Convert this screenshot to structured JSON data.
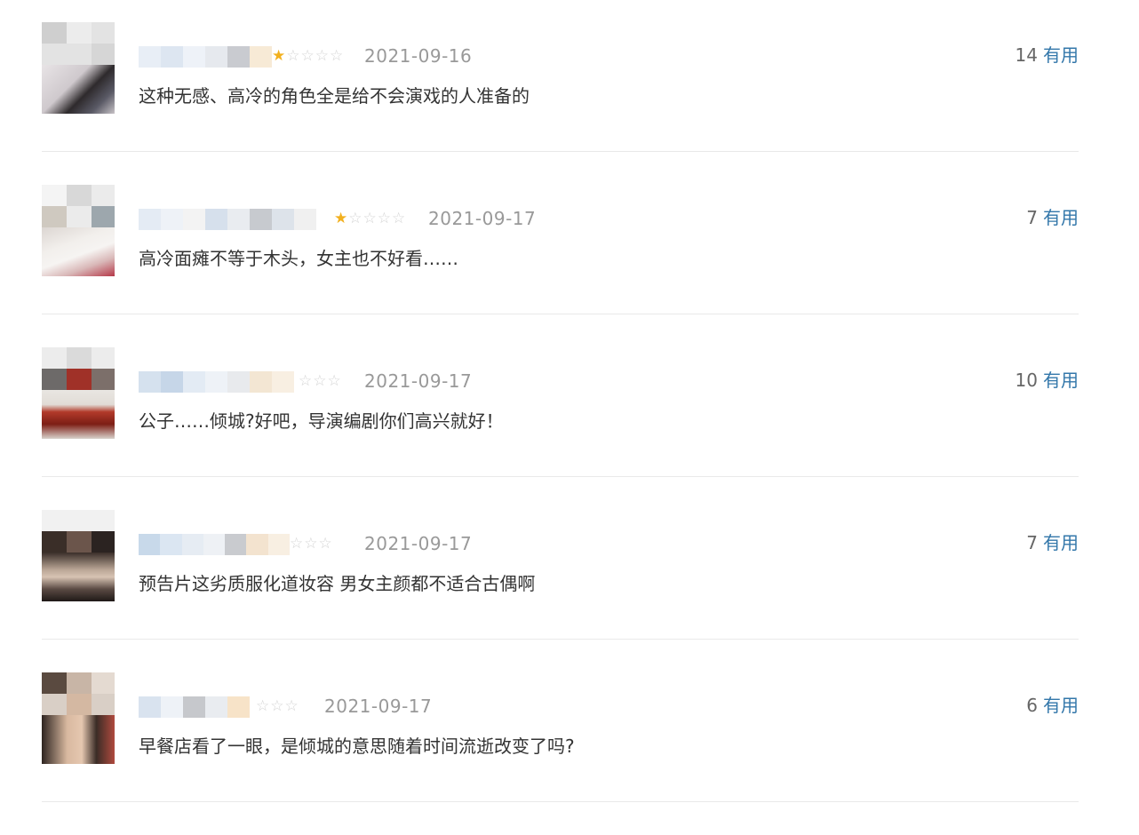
{
  "useful_label": "有用",
  "colors": {
    "star_on": "#f2b01e",
    "star_off": "#d4d4d4",
    "date": "#999999",
    "useful_link": "#3377aa",
    "divider": "#e9e9e9"
  },
  "comments": [
    {
      "stars_on": "★",
      "stars_off": "☆☆☆☆",
      "rating": 1,
      "date": "2021-09-16",
      "votes": "14",
      "text": "这种无感、高冷的角色全是给不会演戏的人准备的"
    },
    {
      "stars_on": "★",
      "stars_off": "☆☆☆☆",
      "rating": 1,
      "date": "2021-09-17",
      "votes": "7",
      "text": "高冷面瘫不等于木头，女主也不好看……"
    },
    {
      "stars_on": "",
      "stars_off": "☆☆☆",
      "rating": 1,
      "date": "2021-09-17",
      "votes": "10",
      "text": "公子……倾城?好吧，导演编剧你们高兴就好！"
    },
    {
      "stars_on": "",
      "stars_off": "☆☆☆",
      "rating": 1,
      "date": "2021-09-17",
      "votes": "7",
      "text": "预告片这劣质服化道妆容 男女主颜都不适合古偶啊"
    },
    {
      "stars_on": "",
      "stars_off": "☆☆☆",
      "rating": 1,
      "date": "2021-09-17",
      "votes": "6",
      "text": "早餐店看了一眼，是倾城的意思随着时间流逝改变了吗?"
    }
  ]
}
